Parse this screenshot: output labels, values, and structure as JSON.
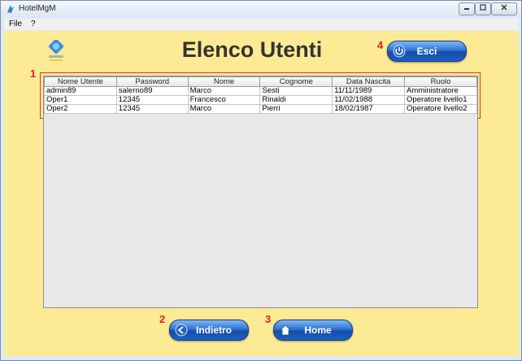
{
  "window": {
    "title": "HotelMgM"
  },
  "menu": {
    "items": [
      "File",
      "?"
    ]
  },
  "page": {
    "title": "Elenco Utenti"
  },
  "markers": {
    "m1": "1",
    "m2": "2",
    "m3": "3",
    "m4": "4"
  },
  "buttons": {
    "exit": "Esci",
    "back": "Indietro",
    "home": "Home"
  },
  "table": {
    "headers": [
      "Nome Utente",
      "Password",
      "Nome",
      "Cognome",
      "Data Nascita",
      "Ruolo"
    ],
    "rows": [
      [
        "admin89",
        "salerno89",
        "Marco",
        "Sesti",
        "11/11/1989",
        "Amministratore"
      ],
      [
        "Oper1",
        "12345",
        "Francesco",
        "Rinaldi",
        "11/02/1988",
        "Operatore livello1"
      ],
      [
        "Oper2",
        "12345",
        "Marco",
        "Pierri",
        "18/02/1987",
        "Operatore livello2"
      ]
    ]
  },
  "colors": {
    "background": "#fceb94",
    "button": "#2f74d4",
    "marker": "#e02020"
  }
}
